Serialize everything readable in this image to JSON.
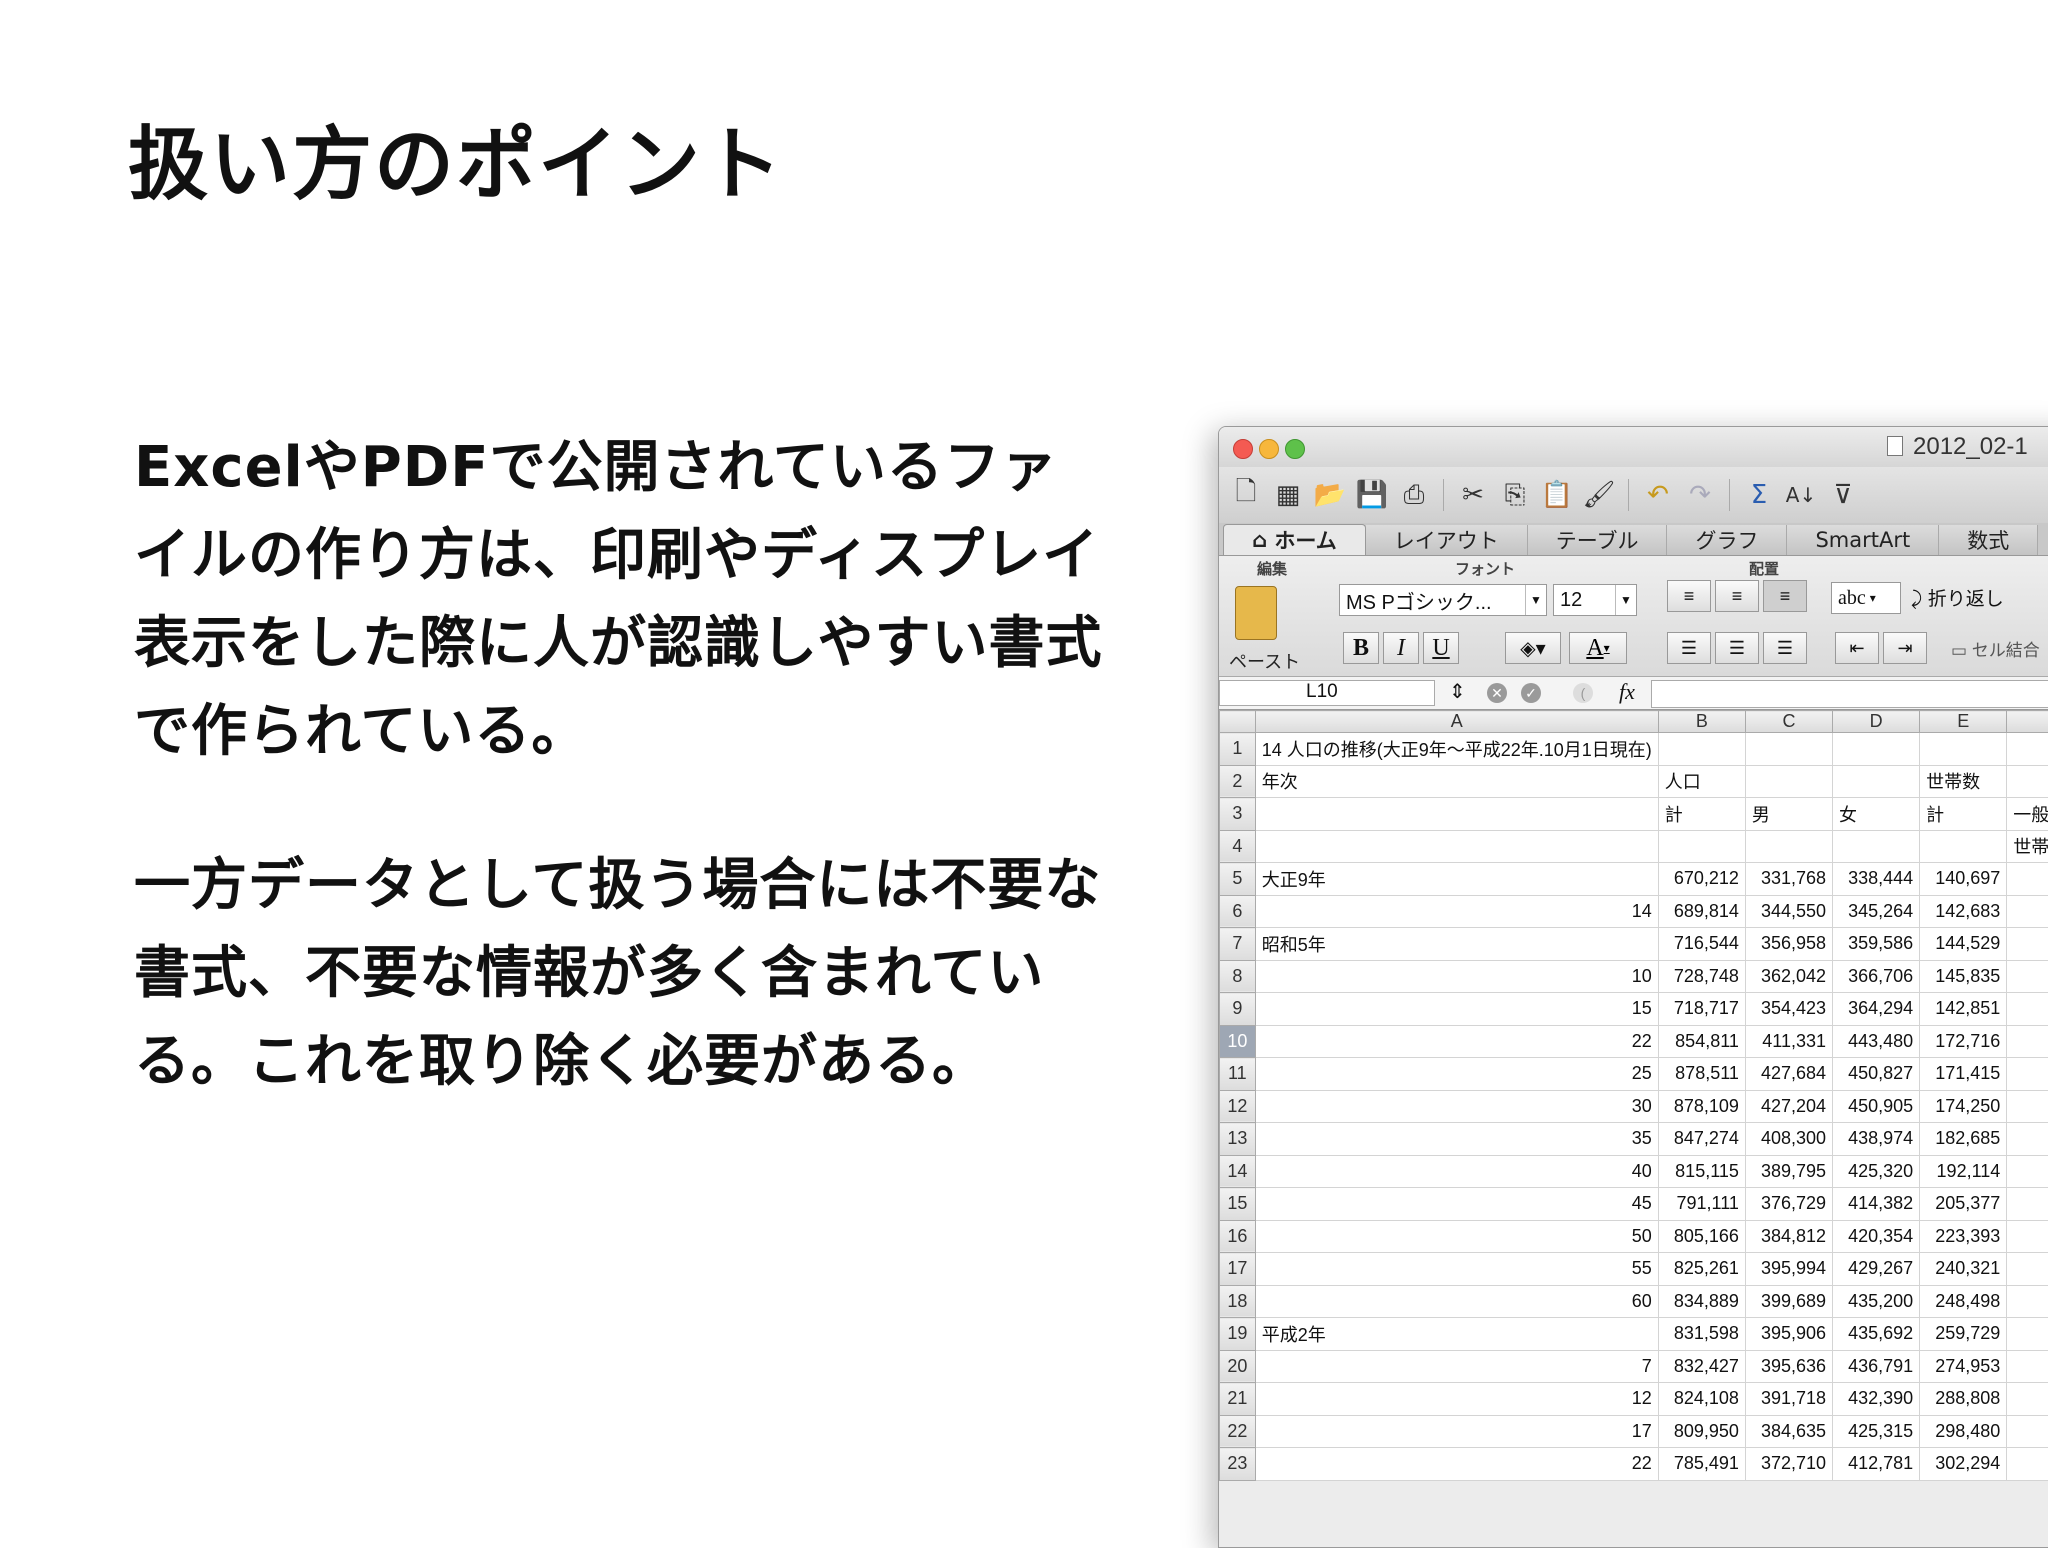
{
  "slide": {
    "title": "扱い方のポイント",
    "paragraph1": "ExcelやPDFで公開されているファイルの作り方は、印刷やディスプレイ表示をした際に人が認識しやすい書式で作られている。",
    "paragraph2": "一方データとして扱う場合には不要な書式、不要な情報が多く含まれている。これを取り除く必要がある。"
  },
  "excel": {
    "window_title": "2012_02-1",
    "tabs": [
      "ホーム",
      "レイアウト",
      "テーブル",
      "グラフ",
      "SmartArt",
      "数式"
    ],
    "ribbon": {
      "group_edit": "編集",
      "group_font": "フォント",
      "group_align": "配置",
      "paste_label": "ペースト",
      "font_name": "MS Pゴシック...",
      "font_size": "12",
      "bold": "B",
      "italic": "I",
      "underline": "U",
      "font_color": "A",
      "orientation": "abc",
      "wrap_text": "折り返し",
      "merge_cells": "セル結合"
    },
    "name_box": "L10",
    "fx_label": "fx",
    "columns": [
      "A",
      "B",
      "C",
      "D",
      "E",
      ""
    ],
    "active_row": "10",
    "rows": [
      {
        "n": "1",
        "cells": [
          "14  人口の推移(大正9年～平成22年.10月1日現在)",
          "",
          "",
          "",
          "",
          ""
        ]
      },
      {
        "n": "2",
        "cells": [
          "年次",
          "人口",
          "",
          "",
          "世帯数",
          ""
        ]
      },
      {
        "n": "3",
        "cells": [
          "",
          "計",
          "男",
          "女",
          "計",
          "一般世"
        ]
      },
      {
        "n": "4",
        "cells": [
          "",
          "",
          "",
          "",
          "",
          "世帯数"
        ]
      },
      {
        "n": "5",
        "cells": [
          "大正9年",
          "670,212",
          "331,768",
          "338,444",
          "140,697",
          ""
        ]
      },
      {
        "n": "6",
        "cells": [
          "14",
          "689,814",
          "344,550",
          "345,264",
          "142,683",
          ""
        ]
      },
      {
        "n": "7",
        "cells": [
          "昭和5年",
          "716,544",
          "356,958",
          "359,586",
          "144,529",
          ""
        ]
      },
      {
        "n": "8",
        "cells": [
          "10",
          "728,748",
          "362,042",
          "366,706",
          "145,835",
          ""
        ]
      },
      {
        "n": "9",
        "cells": [
          "15",
          "718,717",
          "354,423",
          "364,294",
          "142,851",
          ""
        ]
      },
      {
        "n": "10",
        "cells": [
          "22",
          "854,811",
          "411,331",
          "443,480",
          "172,716",
          ""
        ]
      },
      {
        "n": "11",
        "cells": [
          "25",
          "878,511",
          "427,684",
          "450,827",
          "171,415",
          ""
        ]
      },
      {
        "n": "12",
        "cells": [
          "30",
          "878,109",
          "427,204",
          "450,905",
          "174,250",
          ""
        ]
      },
      {
        "n": "13",
        "cells": [
          "35",
          "847,274",
          "408,300",
          "438,974",
          "182,685",
          ""
        ]
      },
      {
        "n": "14",
        "cells": [
          "40",
          "815,115",
          "389,795",
          "425,320",
          "192,114",
          ""
        ]
      },
      {
        "n": "15",
        "cells": [
          "45",
          "791,111",
          "376,729",
          "414,382",
          "205,377",
          ""
        ]
      },
      {
        "n": "16",
        "cells": [
          "50",
          "805,166",
          "384,812",
          "420,354",
          "223,393",
          ""
        ]
      },
      {
        "n": "17",
        "cells": [
          "55",
          "825,261",
          "395,994",
          "429,267",
          "240,321",
          ""
        ]
      },
      {
        "n": "18",
        "cells": [
          "60",
          "834,889",
          "399,689",
          "435,200",
          "248,498",
          ""
        ]
      },
      {
        "n": "19",
        "cells": [
          "平成2年",
          "831,598",
          "395,906",
          "435,692",
          "259,729",
          ""
        ]
      },
      {
        "n": "20",
        "cells": [
          "7",
          "832,427",
          "395,636",
          "436,791",
          "274,953",
          ""
        ]
      },
      {
        "n": "21",
        "cells": [
          "12",
          "824,108",
          "391,718",
          "432,390",
          "288,808",
          ""
        ]
      },
      {
        "n": "22",
        "cells": [
          "17",
          "809,950",
          "384,635",
          "425,315",
          "298,480",
          ""
        ]
      },
      {
        "n": "23",
        "cells": [
          "22",
          "785,491",
          "372,710",
          "412,781",
          "302,294",
          ""
        ]
      }
    ]
  }
}
